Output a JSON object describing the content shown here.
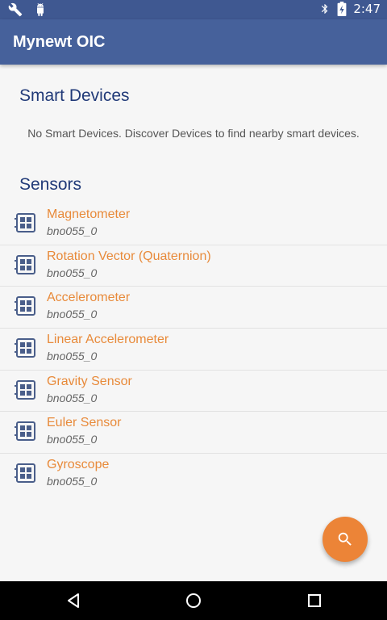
{
  "status_bar": {
    "time": "2:47",
    "icons": [
      "wrench-icon",
      "android-icon",
      "bluetooth-icon",
      "battery-charging-icon"
    ]
  },
  "app_bar": {
    "title": "Mynewt OIC"
  },
  "smart_devices": {
    "heading": "Smart Devices",
    "empty_message": "No Smart Devices. Discover Devices to find nearby smart devices."
  },
  "sensors": {
    "heading": "Sensors",
    "items": [
      {
        "name": "Magnetometer",
        "device": "bno055_0"
      },
      {
        "name": "Rotation Vector (Quaternion)",
        "device": "bno055_0"
      },
      {
        "name": "Accelerometer",
        "device": "bno055_0"
      },
      {
        "name": "Linear Accelerometer",
        "device": "bno055_0"
      },
      {
        "name": "Gravity Sensor",
        "device": "bno055_0"
      },
      {
        "name": "Euler Sensor",
        "device": "bno055_0"
      },
      {
        "name": "Gyroscope",
        "device": "bno055_0"
      }
    ]
  },
  "fab": {
    "icon": "search-icon"
  },
  "nav_bar": {
    "buttons": [
      "back-icon",
      "home-icon",
      "recents-icon"
    ]
  },
  "colors": {
    "app_bar": "#46619b",
    "status_bar": "#3f5891",
    "accent": "#ec8437",
    "heading": "#213a78",
    "sensor_name": "#e88a3a"
  }
}
